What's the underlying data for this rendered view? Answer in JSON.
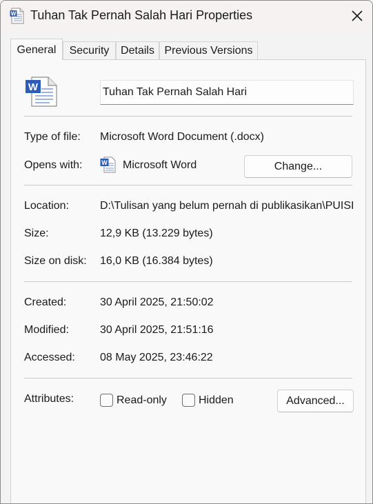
{
  "window": {
    "title": "Tuhan Tak Pernah Salah Hari Properties",
    "title_icon": "word-document-icon",
    "close_icon": "close-icon"
  },
  "tabs": [
    {
      "label": "General",
      "active": true
    },
    {
      "label": "Security",
      "active": false
    },
    {
      "label": "Details",
      "active": false
    },
    {
      "label": "Previous Versions",
      "active": false
    }
  ],
  "general": {
    "file_icon": "word-document-icon",
    "file_name": "Tuhan Tak Pernah Salah Hari",
    "type_label": "Type of file:",
    "type_value": "Microsoft Word Document (.docx)",
    "opens_label": "Opens with:",
    "opens_icon": "microsoft-word-icon",
    "opens_value": "Microsoft Word",
    "change_button": "Change...",
    "location_label": "Location:",
    "location_value": "D:\\Tulisan yang belum pernah di publikasikan\\PUISI",
    "size_label": "Size:",
    "size_value": "12,9 KB (13.229 bytes)",
    "size_on_disk_label": "Size on disk:",
    "size_on_disk_value": "16,0 KB (16.384 bytes)",
    "created_label": "Created:",
    "created_value": "30 April 2025, 21:50:02",
    "modified_label": "Modified:",
    "modified_value": "30 April 2025, 21:51:16",
    "accessed_label": "Accessed:",
    "accessed_value": "08 May 2025, 23:46:22",
    "attributes_label": "Attributes:",
    "readonly_label": "Read-only",
    "readonly_checked": false,
    "hidden_label": "Hidden",
    "hidden_checked": false,
    "advanced_button": "Advanced..."
  },
  "colors": {
    "titlebar_bg": "#f7f2f2",
    "window_bg": "#f3f3f3",
    "panel_bg": "#f9f9f9",
    "word_blue": "#2b5cb8"
  }
}
